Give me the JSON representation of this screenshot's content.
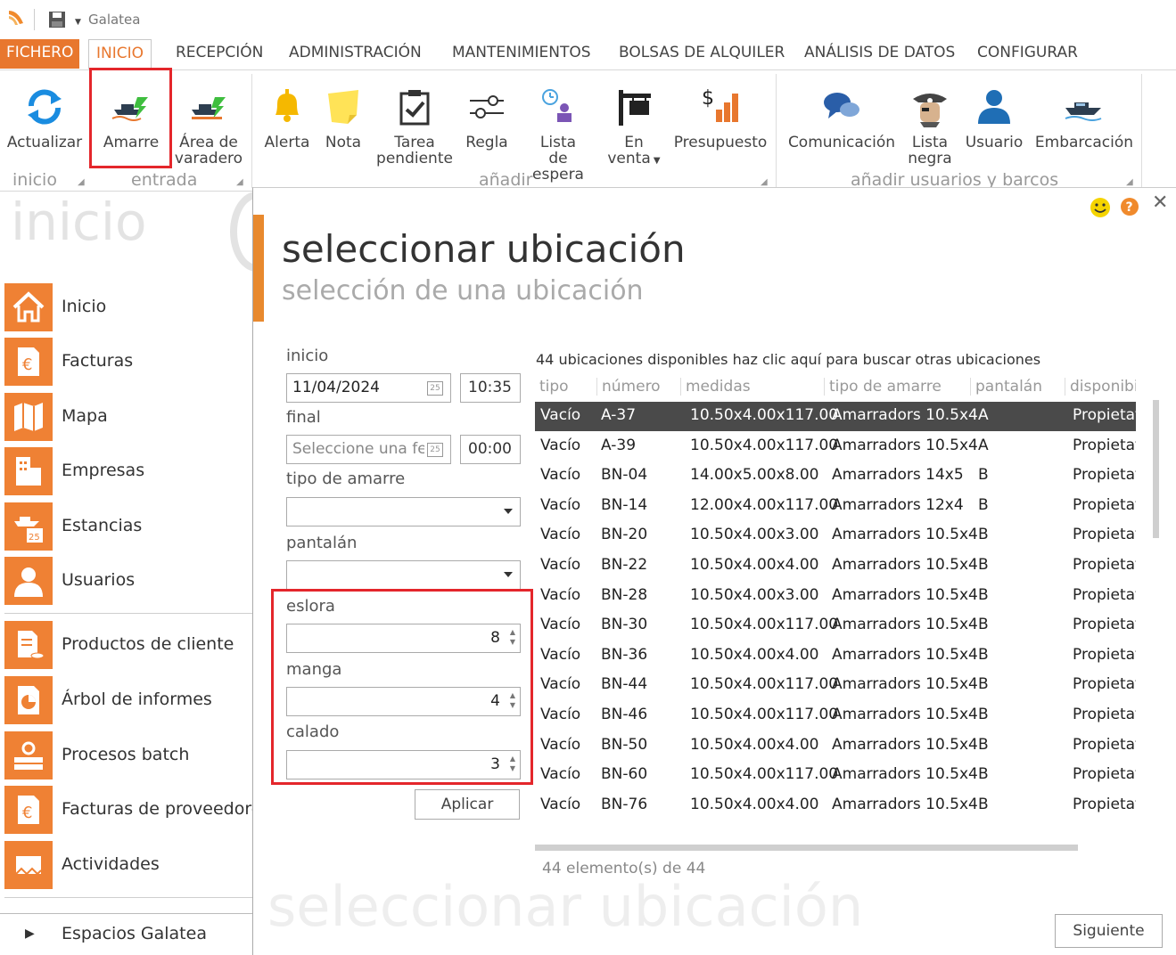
{
  "window": {
    "title": "Galatea"
  },
  "menu": {
    "tabs": [
      {
        "label": "FICHERO"
      },
      {
        "label": "INICIO"
      },
      {
        "label": "RECEPCIÓN"
      },
      {
        "label": "ADMINISTRACIÓN"
      },
      {
        "label": "MANTENIMIENTOS"
      },
      {
        "label": "BOLSAS DE ALQUILER"
      },
      {
        "label": "ANÁLISIS DE DATOS"
      },
      {
        "label": "CONFIGURAR"
      }
    ],
    "active": "INICIO"
  },
  "ribbon": {
    "buttons": {
      "actualizar": "Actualizar",
      "amarre": "Amarre",
      "area_l1": "Área de",
      "area_l2": "varadero",
      "alerta": "Alerta",
      "nota": "Nota",
      "tarea_l1": "Tarea",
      "tarea_l2": "pendiente",
      "regla": "Regla",
      "lista_l1": "Lista",
      "lista_l2": "de espera",
      "enventa_l1": "En",
      "enventa_l2": "venta",
      "presupuesto": "Presupuesto",
      "comunicacion": "Comunicación",
      "negra_l1": "Lista",
      "negra_l2": "negra",
      "usuario": "Usuario",
      "embarcacion": "Embarcación"
    },
    "groups": {
      "inicio": "inicio",
      "entrada": "entrada",
      "anadir": "añadir",
      "usuarios_barcos": "añadir usuarios y barcos"
    }
  },
  "sidebar": {
    "heading": "inicio",
    "items": [
      {
        "label": "Inicio",
        "icon": "home-icon"
      },
      {
        "label": "Facturas",
        "icon": "invoice-euro-icon"
      },
      {
        "label": "Mapa",
        "icon": "map-icon"
      },
      {
        "label": "Empresas",
        "icon": "building-icon"
      },
      {
        "label": "Estancias",
        "icon": "boat-calendar-icon"
      },
      {
        "label": "Usuarios",
        "icon": "user-icon"
      },
      {
        "label": "Productos de cliente",
        "icon": "products-icon"
      },
      {
        "label": "Árbol de informes",
        "icon": "report-tree-icon"
      },
      {
        "label": "Procesos batch",
        "icon": "batch-icon"
      },
      {
        "label": "Facturas de proveedores",
        "icon": "supplier-invoice-icon"
      },
      {
        "label": "Actividades",
        "icon": "activities-icon"
      }
    ],
    "footer": "Espacios Galatea"
  },
  "dialog": {
    "title": "seleccionar ubicación",
    "subtitle": "selección de una ubicación",
    "watermark": "seleccionar ubicación",
    "form": {
      "inicio_label": "inicio",
      "inicio_date": "11/04/2024",
      "inicio_time": "10:35",
      "final_label": "final",
      "final_date_placeholder": "Seleccione una fecha",
      "final_time": "00:00",
      "tipo_label": "tipo de amarre",
      "tipo_value": "",
      "pantalan_label": "pantalán",
      "pantalan_value": "",
      "eslora_label": "eslora",
      "eslora_value": "8",
      "manga_label": "manga",
      "manga_value": "4",
      "calado_label": "calado",
      "calado_value": "3",
      "aplicar": "Aplicar"
    },
    "table": {
      "caption": "44 ubicaciones disponibles  haz clic aquí para buscar otras ubicaciones",
      "columns": [
        "tipo",
        "número",
        "medidas",
        "tipo de amarre",
        "pantalán",
        "disponibilidad"
      ],
      "rows": [
        [
          "Vacío",
          "A-37",
          "10.50x4.00x117.00",
          "Amarradors 10.5x4",
          "A",
          "Propietat"
        ],
        [
          "Vacío",
          "A-39",
          "10.50x4.00x117.00",
          "Amarradors 10.5x4",
          "A",
          "Propietat"
        ],
        [
          "Vacío",
          "BN-04",
          "14.00x5.00x8.00",
          "Amarradors 14x5",
          "B",
          "Propietat"
        ],
        [
          "Vacío",
          "BN-14",
          "12.00x4.00x117.00",
          "Amarradors 12x4",
          "B",
          "Propietat"
        ],
        [
          "Vacío",
          "BN-20",
          "10.50x4.00x3.00",
          "Amarradors 10.5x4",
          "B",
          "Propietat"
        ],
        [
          "Vacío",
          "BN-22",
          "10.50x4.00x4.00",
          "Amarradors 10.5x4",
          "B",
          "Propietat"
        ],
        [
          "Vacío",
          "BN-28",
          "10.50x4.00x3.00",
          "Amarradors 10.5x4",
          "B",
          "Propietat"
        ],
        [
          "Vacío",
          "BN-30",
          "10.50x4.00x117.00",
          "Amarradors 10.5x4",
          "B",
          "Propietat"
        ],
        [
          "Vacío",
          "BN-36",
          "10.50x4.00x4.00",
          "Amarradors 10.5x4",
          "B",
          "Propietat"
        ],
        [
          "Vacío",
          "BN-44",
          "10.50x4.00x117.00",
          "Amarradors 10.5x4",
          "B",
          "Propietat"
        ],
        [
          "Vacío",
          "BN-46",
          "10.50x4.00x117.00",
          "Amarradors 10.5x4",
          "B",
          "Propietat"
        ],
        [
          "Vacío",
          "BN-50",
          "10.50x4.00x4.00",
          "Amarradors 10.5x4",
          "B",
          "Propietat"
        ],
        [
          "Vacío",
          "BN-60",
          "10.50x4.00x117.00",
          "Amarradors 10.5x4",
          "B",
          "Propietat"
        ],
        [
          "Vacío",
          "BN-76",
          "10.50x4.00x4.00",
          "Amarradors 10.5x4",
          "B",
          "Propietat"
        ]
      ],
      "selected_row": 0
    },
    "count": "44 elemento(s) de 44",
    "siguiente": "Siguiente"
  },
  "colors": {
    "accent": "#e8772e",
    "highlight": "#e4262b",
    "selected_row": "#4a4a4a"
  }
}
